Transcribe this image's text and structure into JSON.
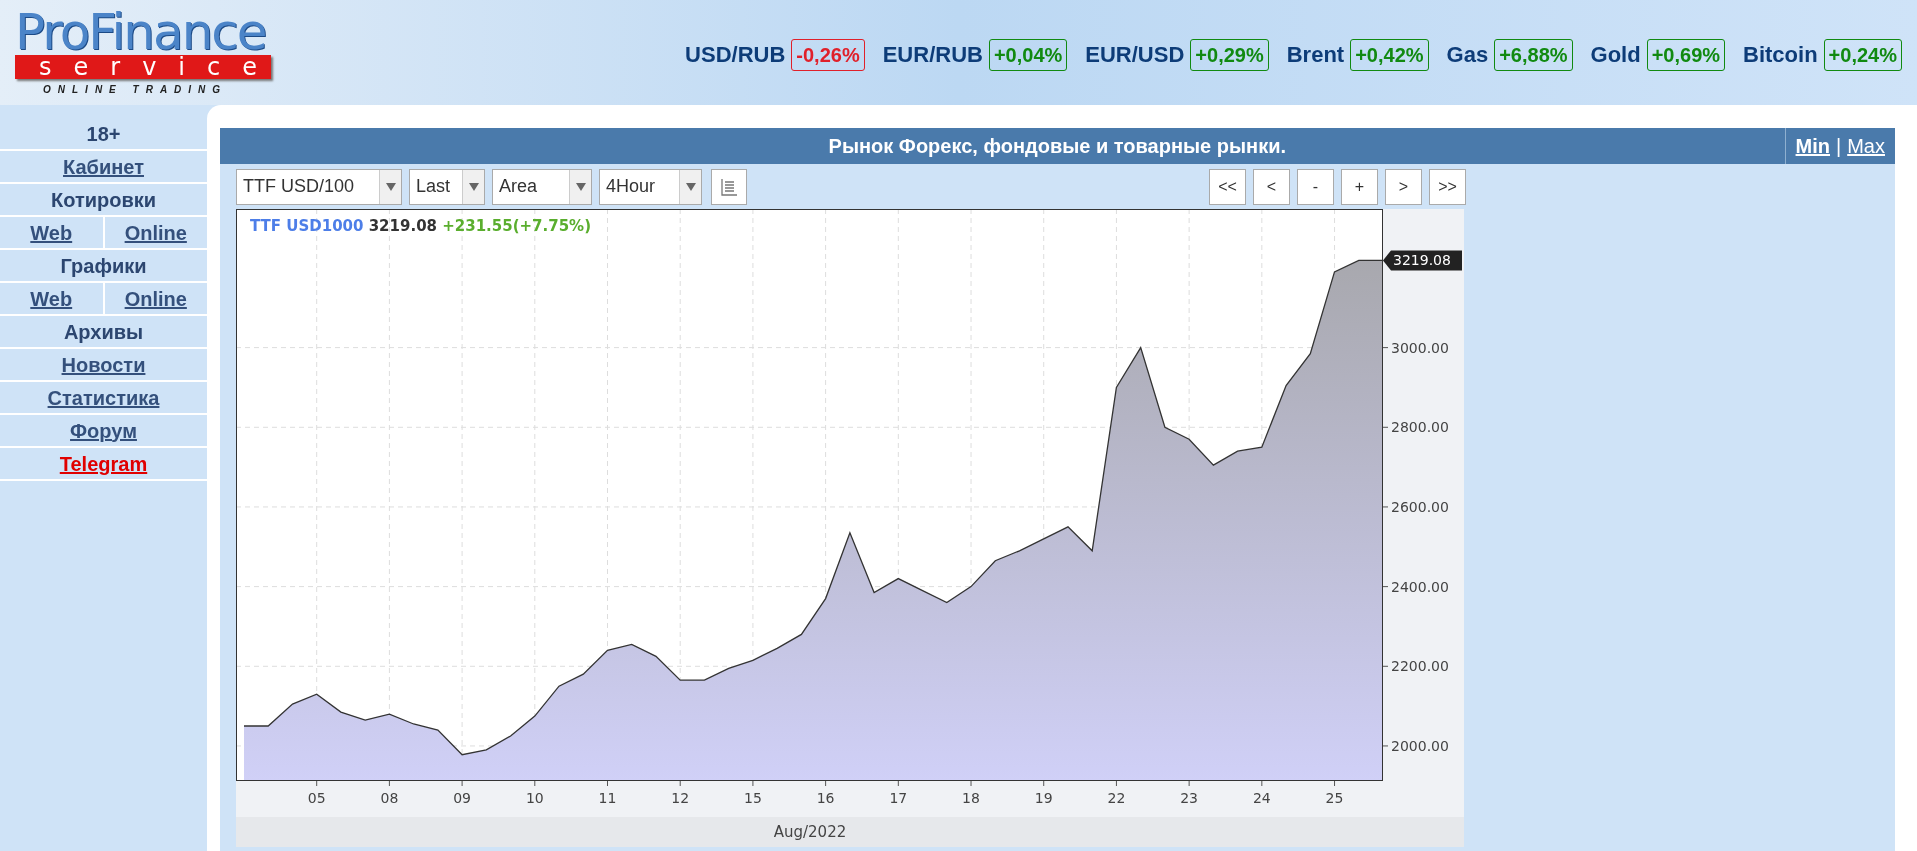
{
  "logo": {
    "brand": "ProFinance",
    "service": "service",
    "tagline": "ONLINE TRADING"
  },
  "ticker": [
    {
      "symbol": "USD/RUB",
      "change": "-0,26%",
      "color": "#e0202a"
    },
    {
      "symbol": "EUR/RUB",
      "change": "+0,04%",
      "color": "#118a11"
    },
    {
      "symbol": "EUR/USD",
      "change": "+0,29%",
      "color": "#118a11"
    },
    {
      "symbol": "Brent",
      "change": "+0,42%",
      "color": "#118a11"
    },
    {
      "symbol": "Gas",
      "change": "+6,88%",
      "color": "#118a11"
    },
    {
      "symbol": "Gold",
      "change": "+0,69%",
      "color": "#118a11"
    },
    {
      "symbol": "Bitcoin",
      "change": "+0,24%",
      "color": "#118a11"
    }
  ],
  "sidebar": {
    "items": [
      {
        "kind": "label",
        "label": "18+"
      },
      {
        "kind": "link",
        "label": "Кабинет"
      },
      {
        "kind": "label",
        "label": "Котировки"
      },
      {
        "kind": "pair",
        "links": [
          "Web",
          "Online"
        ]
      },
      {
        "kind": "label",
        "label": "Графики"
      },
      {
        "kind": "pair",
        "links": [
          "Web",
          "Online"
        ]
      },
      {
        "kind": "label",
        "label": "Архивы"
      },
      {
        "kind": "link",
        "label": "Новости"
      },
      {
        "kind": "link",
        "label": "Статистика"
      },
      {
        "kind": "link",
        "label": "Форум"
      },
      {
        "kind": "hot-link",
        "label": "Telegram"
      }
    ]
  },
  "panel": {
    "title": "Рынок Форекс, фондовые и товарные рынки.",
    "size_links": [
      {
        "label": "Min",
        "selected": true
      },
      {
        "label": "Max",
        "selected": false
      }
    ],
    "separator": "|"
  },
  "toolbar": {
    "dropdowns": [
      "TTF USD/100",
      "Last",
      "Area",
      "4Hour"
    ],
    "nav_buttons": [
      "<<",
      "<",
      "-",
      "+",
      ">",
      ">>"
    ]
  },
  "chart": {
    "legend": {
      "last": "3219.08",
      "change": "+231.55(+7.75%)"
    },
    "price_tag": "3219.08",
    "chart_data": {
      "type": "area",
      "grid": true,
      "xlabel": "Aug/2022",
      "ylim": [
        1912,
        3348
      ],
      "categories": [
        null,
        null,
        null,
        "05",
        null,
        null,
        "08",
        null,
        null,
        "09",
        null,
        null,
        "10",
        null,
        null,
        "11",
        null,
        null,
        "12",
        null,
        null,
        "15",
        null,
        null,
        "16",
        null,
        null,
        "17",
        null,
        null,
        "18",
        null,
        null,
        "19",
        null,
        null,
        "22",
        null,
        null,
        "23",
        null,
        null,
        "24",
        null,
        null,
        "25",
        null,
        null
      ],
      "yticks": [
        {
          "value": 2000,
          "label": "2000.00"
        },
        {
          "value": 2200,
          "label": "2200.00"
        },
        {
          "value": 2400,
          "label": "2400.00"
        },
        {
          "value": 2600,
          "label": "2600.00"
        },
        {
          "value": 2800,
          "label": "2800.00"
        },
        {
          "value": 3000,
          "label": "3000.00"
        }
      ],
      "series": [
        {
          "name": "TTF USD1000",
          "color": "#333333",
          "values": [
            2050,
            2050,
            2105,
            2130,
            2085,
            2065,
            2080,
            2055,
            2040,
            1978,
            1990,
            2025,
            2075,
            2150,
            2180,
            2240,
            2255,
            2225,
            2165,
            2165,
            2195,
            2215,
            2245,
            2280,
            2370,
            2535,
            2385,
            2420,
            2390,
            2360,
            2400,
            2465,
            2490,
            2520,
            2550,
            2490,
            2900,
            3000,
            2800,
            2770,
            2705,
            2740,
            2750,
            2905,
            2985,
            3190,
            3219,
            3219
          ]
        }
      ]
    }
  }
}
